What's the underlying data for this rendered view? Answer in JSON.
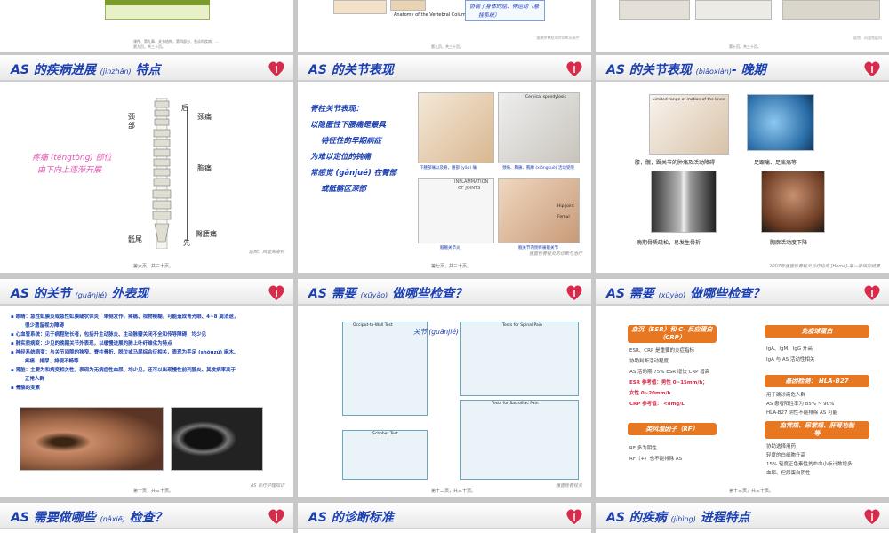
{
  "top_row": {
    "s1_footer": "课件、第九章、关节结构，第四部分、急诊科疾病、...",
    "s1_subfooter": "第九页，共三十页。",
    "s2_caption": "Anatomy of the Vertebral Column",
    "s2_note1": "协调了身体的屈、伸运动（悬",
    "s2_note2": "挂系统）",
    "s2_footer": "第九页，共三十页。",
    "s2_footer2": "强直性脊柱炎的诊断与治疗",
    "s3_footer": "第十页，共三十页。",
    "s3_footer2": "医院、风湿免疫科"
  },
  "slides": {
    "s4": {
      "title": "AS 的疾病进展",
      "title_py": "(jìnzhǎn)",
      "title_end": " 特点",
      "label_neck_l": "颈",
      "label_neck_l2": "部",
      "label_back": "后",
      "label_neck_pain": "颈痛",
      "label_chest_pain": "胸痛",
      "label_sacrum": "骶尾",
      "label_first": "先",
      "label_hip_pain": "臀腰痛",
      "pink_line1": "疼痛 (téngtòng) 部位",
      "pink_line2": "由下向上逐渐开展",
      "footer": "第六页，共三十页。",
      "footer2": "医院、风湿免疫科"
    },
    "s5": {
      "title": "AS 的关节表现",
      "line1": "脊柱关节表现：",
      "line2": "以隐匿性下腰痛是最具",
      "line3": "特征性的早期病症",
      "line4": "为难以定位的钝痛",
      "line5": "常感觉 (gǎnjué) 在臀部",
      "line6": "或骶髂区深部",
      "cap1": "下腰部痛以及脊，腰部 (yāo) 痛",
      "cap2": "颈痛、胸痛、胸廓 (xiōngkuò) 活动受限",
      "cap3": "骶髂关节炎",
      "cap4": "髋关节内侧疼痛髋关节",
      "cervical": "Cervical spondylosis",
      "inflam1": "INFLAMMATION",
      "inflam2": "OF JOINTS",
      "hip": "Hip joint",
      "femur": "Femur",
      "footer": "第七页，共三十页。",
      "footer2": "强直性脊柱炎的诊断与治疗"
    },
    "s6": {
      "title": "AS 的关节表现",
      "title_py": "(biǎoxiàn)",
      "title_end": "- 晚期",
      "cap1": "膝，髋，踝关节的肿痛及活动障碍",
      "cap2": "足跟痛、足底痛等",
      "cap3": "晚期骨质疏松，易发生骨折",
      "cap4": "胸廓活动度下降",
      "limited": "Limited range of motion of the knee",
      "footer": "2007年强直性脊柱炎诊疗指南 [Home]-第一批研究结果"
    },
    "s7": {
      "title": "AS 的关节",
      "title_py": "(guānjié)",
      "title_end": " 外表现",
      "items": [
        "眼睛：急性虹膜炎或急性虹膜睫状体炎，单侧发作，疼痛、视物模糊，可能造成青光眼、4~8 周消退，",
        "很少遗留视力障碍",
        "心血管系统：见于病程较长者，包括升主动脉炎、主动脉瓣关闭不全和传导障碍，均少见",
        "肺实质病变：少见的晚期关节外表现，以缓慢进展的肺上叶纤维化为特点",
        "神经系统病变：与关节间隙的狭窄、脊柱骨折、脱位或马尾综合征相关，表现为手足 (shǒuzú) 麻木、",
        "疼痛、排尿、排便不畅等",
        "肾脏：主要为和病变相关性，表现为无病症性血尿、均少见，还可以出现慢性前列腺炎、其发病率高于",
        "正常人群",
        "骨骼的变累"
      ],
      "footer": "第十页，共三十页。",
      "footer2": "AS 诊疗护理知识"
    },
    "s8": {
      "title": "AS 需要",
      "title_py": "(xūyào)",
      "title_end": " 做哪些检查？",
      "label_joint": "关节 (guānjié) 检查",
      "box1": "Occiput-to-Wall Test",
      "box2": "Tests for Spinal Pain",
      "box3": "Schober Test",
      "box4": "Tests for Sacroiliac Pain",
      "footer": "第十二页，共三十页。",
      "footer2": "强直性脊柱炎"
    },
    "s9": {
      "title": "AS 需要",
      "title_py": "(xūyào)",
      "title_end": " 做哪些检查？",
      "box_esr": "血沉（ESR）和 C- 反应蛋白（CRP）",
      "esr_lines": [
        "ESR、CRP 是重要的炎症指标",
        "协助判断活动程度",
        "AS 活动期 75% ESR 增快 CRP 增高",
        "ESR 参考值：男性 0~15mm/h；",
        "女性 0~20mm/h",
        "CRP 参考值：  <8mg/L"
      ],
      "box_rf": "类风湿因子（RF）",
      "rf_lines": [
        "RF 多为阴性",
        "RF（+）也不能排除 AS"
      ],
      "box_ig": "免疫球蛋白",
      "ig_lines": [
        "IgA、IgM、IgG 升高",
        "IgA 与 AS 活动性相关"
      ],
      "box_hla": "基因检测：  HLA-B27",
      "hla_lines": [
        "用于确诊高危人群",
        "AS 患者阳性率为 85% ~ 90%",
        "HLA-B27 阴性不能排除 AS 可能"
      ],
      "box_blood": "血常规、尿常规、肝肾功能等",
      "blood_lines": [
        "协助选择用药",
        "轻度的白细胞升高",
        "15% 轻度正色素性贫血血小板计数增多",
        "血尿、但尿蛋白阴性"
      ],
      "footer": "第十三页，共三十页。"
    },
    "s10": {
      "title": "AS 需要做哪些",
      "title_py": "(nǎxiē)",
      "title_end": " 检查？"
    },
    "s11": {
      "title": "AS 的诊断标准"
    },
    "s12": {
      "title": "AS 的疾病",
      "title_py": "(jíbìng)",
      "title_end": " 进程特点"
    }
  },
  "colors": {
    "title_blue": "#1a3fb0",
    "accent_orange": "#e87722",
    "pink_text": "#e055b0",
    "logo_red": "#d62b4a"
  }
}
